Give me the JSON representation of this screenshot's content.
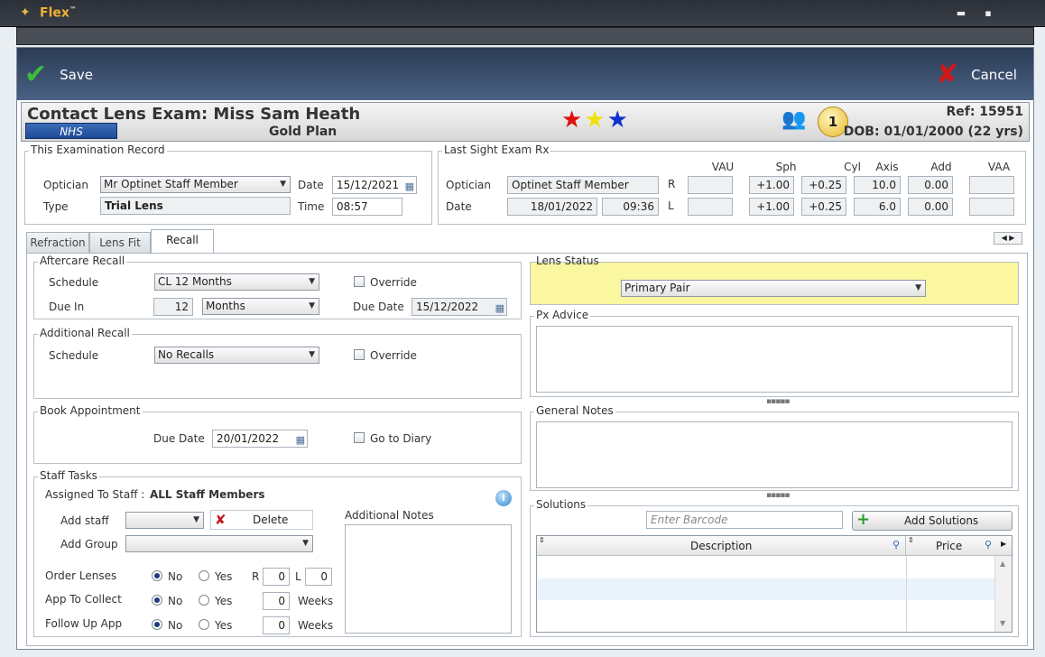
{
  "window": {
    "app_title": "Flex",
    "tm": "™",
    "minimize": "▬",
    "maximize": "▪"
  },
  "toolbar": {
    "save_label": "Save",
    "cancel_label": "Cancel"
  },
  "header": {
    "title": "Contact Lens Exam: Miss Sam Heath",
    "badge": "NHS",
    "plan": "Gold Plan",
    "ref": "Ref: 15951",
    "dob": "DOB: 01/01/2000 (22 yrs)",
    "count_badge": "1",
    "star_colors": [
      "#e01010",
      "#f0e010",
      "#1030d0"
    ]
  },
  "exam_record": {
    "legend": "This Examination Record",
    "optician_label": "Optician",
    "optician_value": "Mr Optinet Staff Member",
    "date_label": "Date",
    "date_value": "15/12/2021",
    "type_label": "Type",
    "type_value": "Trial Lens",
    "time_label": "Time",
    "time_value": "08:57"
  },
  "sight_exam": {
    "legend": "Last Sight Exam Rx",
    "optician_label": "Optician",
    "optician_value": "Optinet Staff Member",
    "date_label": "Date",
    "date_value": "18/01/2022",
    "time_value": "09:36",
    "columns": [
      "VAU",
      "Sph",
      "Cyl",
      "Axis",
      "Add",
      "VAA"
    ],
    "rows": [
      {
        "eye": "R",
        "vau": "",
        "sph": "+1.00",
        "cyl": "+0.25",
        "axis": "10.0",
        "add": "0.00",
        "vaa": ""
      },
      {
        "eye": "L",
        "vau": "",
        "sph": "+1.00",
        "cyl": "+0.25",
        "axis": "6.0",
        "add": "0.00",
        "vaa": ""
      }
    ]
  },
  "tabs": [
    {
      "label": "Refraction"
    },
    {
      "label": "Lens Fit"
    },
    {
      "label": "Recall",
      "active": true
    }
  ],
  "aftercare": {
    "legend": "Aftercare Recall",
    "schedule_label": "Schedule",
    "schedule_value": "CL 12 Months",
    "override_label": "Override",
    "due_in_label": "Due In",
    "due_in_value": "12",
    "due_in_unit": "Months",
    "due_date_label": "Due Date",
    "due_date_value": "15/12/2022"
  },
  "additional_recall": {
    "legend": "Additional Recall",
    "schedule_label": "Schedule",
    "schedule_value": "No Recalls",
    "override_label": "Override"
  },
  "book_appointment": {
    "legend": "Book Appointment",
    "due_date_label": "Due Date",
    "due_date_value": "20/01/2022",
    "diary_label": "Go to Diary"
  },
  "staff_tasks": {
    "legend": "Staff Tasks",
    "assigned_label": "Assigned To Staff :",
    "assigned_value": "ALL Staff Members",
    "add_staff_label": "Add staff",
    "delete_label": "Delete",
    "add_group_label": "Add Group",
    "additional_notes_label": "Additional Notes",
    "order_lenses_label": "Order Lenses",
    "app_to_collect_label": "App To Collect",
    "follow_up_label": "Follow Up App",
    "no_label": "No",
    "yes_label": "Yes",
    "r_label": "R",
    "l_label": "L",
    "order_r": "0",
    "order_l": "0",
    "collect_weeks": "0",
    "follow_weeks": "0",
    "weeks_label": "Weeks"
  },
  "lens_status": {
    "legend": "Lens Status",
    "value": "Primary Pair",
    "bg": "#fbf6a0"
  },
  "px_advice": {
    "legend": "Px Advice"
  },
  "general_notes": {
    "legend": "General Notes"
  },
  "solutions": {
    "legend": "Solutions",
    "barcode_placeholder": "Enter Barcode",
    "add_label": "Add Solutions",
    "col_description": "Description",
    "col_price": "Price"
  }
}
